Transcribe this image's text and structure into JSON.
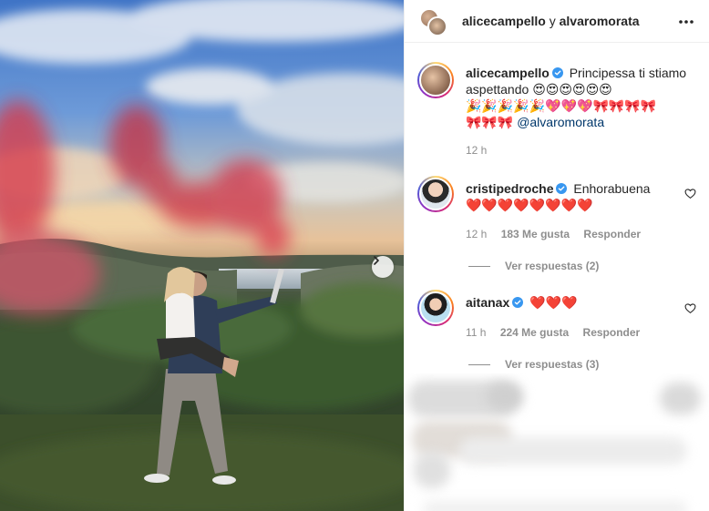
{
  "post": {
    "header_user1": "alicecampello",
    "header_connector": "y",
    "header_user2": "alvaromorata",
    "caption": {
      "username": "alicecampello",
      "text": "Principessa ti stiamo aspettando",
      "emojis_line1": "😍😍😍😍😍😍",
      "emojis_line2": "🎉🎉🎉🎉🎉💖💖💖🎀🎀🎀🎀",
      "emojis_line3": "🎀🎀🎀",
      "mention": "@alvaromorata",
      "time": "12 h"
    }
  },
  "comments": [
    {
      "username": "cristipedroche",
      "text": "Enhorabuena",
      "emojis": "❤️❤️❤️❤️❤️❤️❤️❤️",
      "time": "12 h",
      "likes": "183 Me gusta",
      "reply": "Responder",
      "view_replies": "Ver respuestas (2)"
    },
    {
      "username": "aitanax",
      "text": "",
      "emojis": "❤️❤️❤️",
      "time": "11 h",
      "likes": "224 Me gusta",
      "reply": "Responder",
      "view_replies": "Ver respuestas (3)"
    }
  ],
  "icons": {
    "more": "more-horizontal-icon",
    "verified": "verified-badge-icon",
    "like": "heart-outline-icon",
    "next": "chevron-right-icon"
  },
  "colors": {
    "verified_blue": "#3897f0",
    "meta_gray": "#8e8e8e",
    "mention_blue": "#00376b",
    "smoke_red": "#d6384a"
  }
}
